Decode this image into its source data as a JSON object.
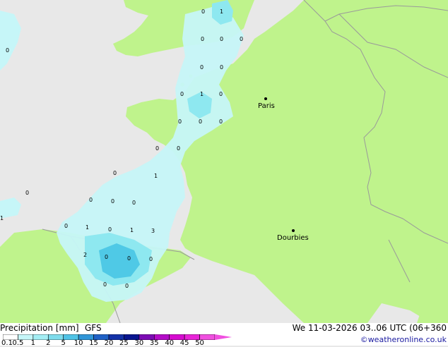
{
  "map": {
    "colors": {
      "sea": "#e8e8e8",
      "land": "#bff38c",
      "border": "#9a9a9a",
      "precip_light": "#c6f6f8",
      "precip_mid": "#8ee8f0",
      "precip_heavy": "#4fc9e6"
    },
    "cities": [
      {
        "name": "Paris"
      },
      {
        "name": "Dourbies"
      }
    ],
    "values": [
      "0",
      "1",
      "0",
      "0",
      "0",
      "0",
      "0",
      "0",
      "1",
      "0",
      "0",
      "0",
      "0",
      "0",
      "0",
      "0",
      "1",
      "0",
      "0",
      "0",
      "0",
      "0",
      "1",
      "1",
      "0",
      "0",
      "1",
      "3",
      "2",
      "0",
      "0",
      "0",
      "0"
    ]
  },
  "footer": {
    "title": "Precipitation [mm]",
    "model": "GFS",
    "datetime": "We 11-03-2026 03..06 UTC (06+360",
    "credit": "©weatheronline.co.uk",
    "scale_labels": [
      "0.1",
      "0.5",
      "1",
      "2",
      "5",
      "10",
      "15",
      "20",
      "25",
      "30",
      "35",
      "40",
      "45",
      "50"
    ],
    "scale_colors": [
      "#ffffff",
      "#c6f6f8",
      "#a4eef4",
      "#7edcec",
      "#4fc3e6",
      "#3196d8",
      "#1f61c6",
      "#1432a8",
      "#0a1690",
      "#7c0cb4",
      "#b40cc8",
      "#d60cd0",
      "#e824d8",
      "#f050e0"
    ]
  }
}
